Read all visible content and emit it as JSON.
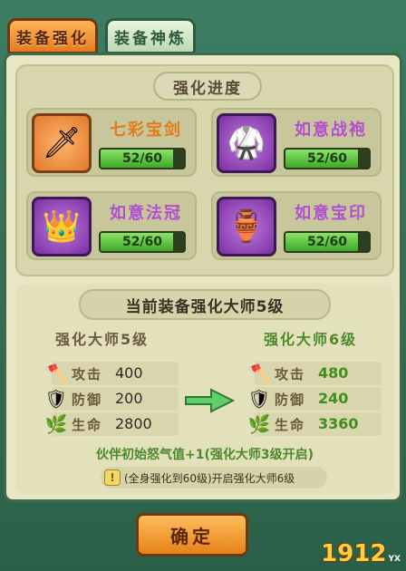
{
  "tabs": {
    "active": "装备强化",
    "inactive": "装备神炼"
  },
  "progress": {
    "title": "强化进度",
    "items": [
      {
        "name": "七彩宝剑",
        "value": "52/60",
        "fraction": 0.867,
        "icon": "sword-icon",
        "glyph": "🗡"
      },
      {
        "name": "如意战袍",
        "value": "52/60",
        "fraction": 0.867,
        "icon": "armor-icon",
        "glyph": "🥋"
      },
      {
        "name": "如意法冠",
        "value": "52/60",
        "fraction": 0.867,
        "icon": "crown-icon",
        "glyph": "👑"
      },
      {
        "name": "如意宝印",
        "value": "52/60",
        "fraction": 0.867,
        "icon": "seal-icon",
        "glyph": "🏺"
      }
    ]
  },
  "master": {
    "title": "当前装备强化大师5级",
    "current_level": "强化大师5级",
    "next_level": "强化大师6级",
    "stats_current": [
      {
        "label": "攻击",
        "value": "400",
        "icon": "attack-icon",
        "glyph": "🪓"
      },
      {
        "label": "防御",
        "value": "200",
        "icon": "defense-icon",
        "glyph": "🛡"
      },
      {
        "label": "生命",
        "value": "2800",
        "icon": "health-icon",
        "glyph": "🌿"
      }
    ],
    "stats_next": [
      {
        "label": "攻击",
        "value": "480",
        "icon": "attack-icon",
        "glyph": "🪓"
      },
      {
        "label": "防御",
        "value": "240",
        "icon": "defense-icon",
        "glyph": "🛡"
      },
      {
        "label": "生命",
        "value": "3360",
        "icon": "health-icon",
        "glyph": "🌿"
      }
    ],
    "bonus_text": "伙伴初始怒气值+1(强化大师3级开启)",
    "tip_icon": "!",
    "tip_text": "(全身强化到60级)开启强化大师6级"
  },
  "confirm_label": "确定",
  "watermark": {
    "main": "1912",
    "sub": "YX"
  }
}
